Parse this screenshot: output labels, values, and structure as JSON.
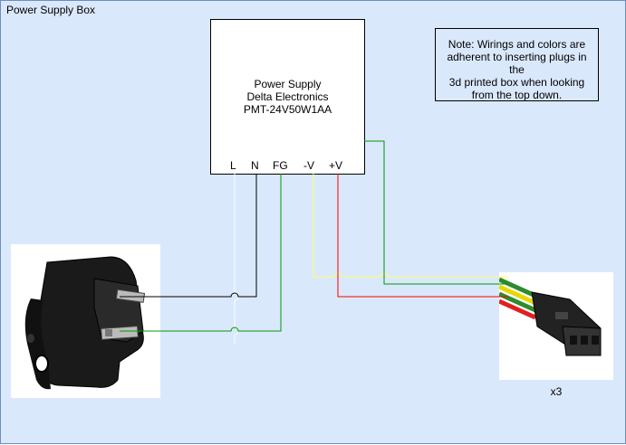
{
  "frame": {
    "title": "Power Supply Box"
  },
  "power_supply": {
    "line1": "Power Supply",
    "line2": "Delta Electronics",
    "line3": "PMT-24V50W1AA",
    "pins": {
      "l": "L",
      "n": "N",
      "fg": "FG",
      "minus_v": "-V",
      "plus_v": "+V"
    }
  },
  "note": {
    "line1": "Note: Wirings and colors are",
    "line2": "adherent to inserting plugs in the",
    "line3": "3d printed box when looking",
    "line4": "from the top down."
  },
  "connector": {
    "quantity": "x3"
  },
  "wire_colors": {
    "live": "#ffffff",
    "neutral": "#000000",
    "ground": "#009900",
    "negative": "#ffff66",
    "positive": "#ff0000",
    "extra": "#009900"
  }
}
